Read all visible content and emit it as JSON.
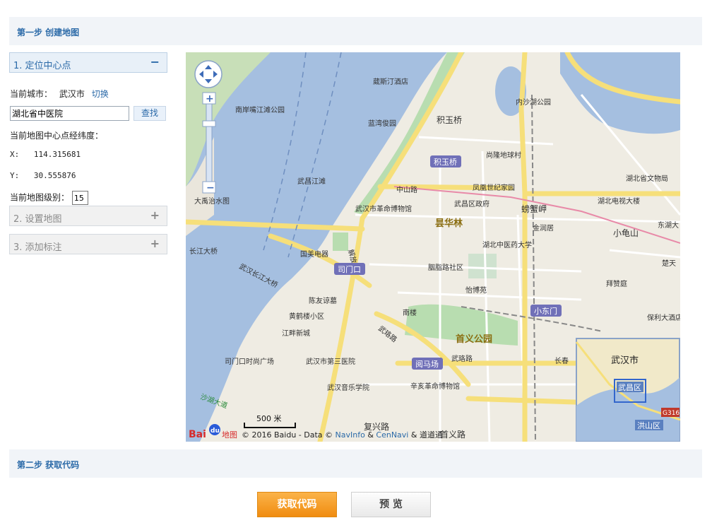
{
  "step1": {
    "title": "第一步 创建地图"
  },
  "step2": {
    "title": "第二步 获取代码"
  },
  "panel": {
    "locate_title": "1. 定位中心点",
    "locate_toggle": "−",
    "city_label": "当前城市：",
    "city_name": "武汉市",
    "switch_link": "切换",
    "search_value": "湖北省中医院",
    "search_button": "查找",
    "center_label": "当前地图中心点经纬度：",
    "x_label": "X:",
    "x_value": "114.315681",
    "y_label": "Y:",
    "y_value": "30.555876",
    "zoom_label": "当前地图级别：",
    "zoom_value": "15",
    "set_map_title": "2. 设置地图",
    "set_map_toggle": "+",
    "add_marker_title": "3. 添加标注",
    "add_marker_toggle": "+"
  },
  "map": {
    "labels": {
      "weisiting": "葳斯汀酒店",
      "nanan": "南岸嘴江滩公园",
      "neisha": "内沙湖公园",
      "lanwan": "蓝湾俊园",
      "jiyuqiao": "积玉桥",
      "shanglong": "尚隆地球村",
      "wuchang_jiangtan": "武昌江滩",
      "fenghuang": "凤凰世纪家园",
      "zhongshanlu": "中山路",
      "hubei_museum": "湖北省文物局",
      "dayu": "大禹治水图",
      "wuchang_gov": "武昌区政府",
      "pangxiejia": "螃蟹岬",
      "hubei_tv": "湖北电视大楼",
      "revolution_museum": "武汉市革命博物馆",
      "jinrun": "金润居",
      "xiaoguishan": "小龟山",
      "donghu": "东湖大",
      "yanghualin": "昙华林",
      "tcm_univ": "湖北中医药大学",
      "jiefanglu": "解放路",
      "changjiang_bridge": "长江大桥",
      "gome": "国美电器",
      "simenkou": "司门口",
      "yanzhi": "胭脂路社区",
      "chutian": "楚天",
      "wuchang_bridge": "武汉长江大桥",
      "zhongshanlu2": "中山路",
      "yibo": "怡博苑",
      "baizan": "拜赞庭",
      "chenyou": "陈友谅墓",
      "nanlou": "南楼",
      "xiaodongmen": "小东门",
      "huanghelou": "黄鹤楼小区",
      "baoli": "保利大酒店",
      "jiangpan": "江畔新城",
      "wulu": "武珞路",
      "shouyi": "首义公园",
      "simenkou_plaza": "司门口时尚广场",
      "third_hospital": "武汉市第三医院",
      "yuemachang": "阅马场",
      "wulu2": "武珞路",
      "changchun": "长春",
      "music_college": "武汉音乐学院",
      "xinhai": "辛亥革命博物馆",
      "fuxinglu": "复兴路",
      "shouyilu": "首义路",
      "shahu": "沙湖大道",
      "minimap_city": "武汉市",
      "minimap_district": "武昌区",
      "minimap_hongshan": "洪山区",
      "minimap_g316": "G316",
      "scale": "500 米",
      "logo_text": "Bai",
      "logo_du": "du",
      "logo_map": "地图",
      "copyright": "© 2016 Baidu - Data © ",
      "navinfo": "NavInfo",
      "amp": " & ",
      "cennavi": "CenNavi",
      "amp2": " & 道道通"
    }
  },
  "buttons": {
    "get_code": "获取代码",
    "preview": "预 览"
  },
  "colors": {
    "accent": "#2b6aa8",
    "water": "#a5bfe0",
    "road": "#f8e68a",
    "park": "#b8ddb0",
    "orange_button": "#f5a12b"
  }
}
